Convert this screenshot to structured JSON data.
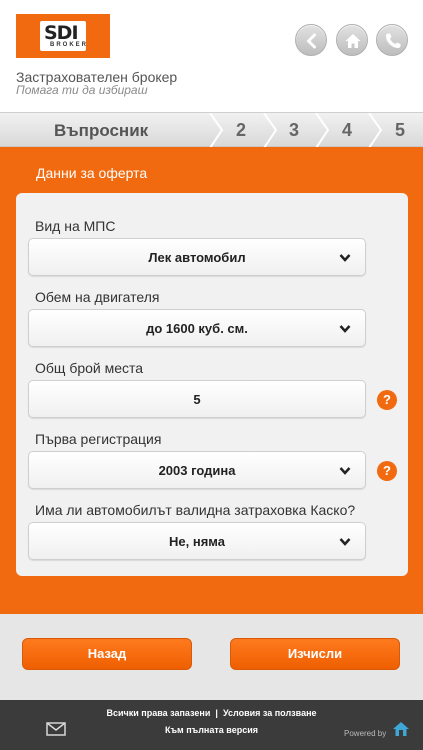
{
  "header": {
    "logo_text": "SDI",
    "logo_sub": "BROKER",
    "tagline": "Застрахователен брокер",
    "subtagline": "Помага ти да избираш",
    "icons": [
      "back-icon",
      "home-icon",
      "phone-icon"
    ]
  },
  "steps": {
    "current": "Въпросник",
    "others": [
      "2",
      "3",
      "4",
      "5"
    ]
  },
  "panel": {
    "title": "Данни за оферта"
  },
  "form": {
    "vehicle_type": {
      "label": "Вид на МПС",
      "value": "Лек автомобил"
    },
    "engine": {
      "label": "Обем на двигателя",
      "value": "до 1600 куб. см."
    },
    "seats": {
      "label": "Общ брой места",
      "value": "5"
    },
    "registration": {
      "label": "Първа регистрация",
      "value": "2003 година"
    },
    "casco": {
      "label": "Има ли автомобилът валидна затраховка Каско?",
      "value": "Не, няма"
    }
  },
  "buttons": {
    "back": "Назад",
    "calculate": "Изчисли"
  },
  "footer": {
    "rights": "Всички права запазени",
    "separator": "|",
    "terms": "Условия за ползване",
    "full_version": "Към пълната версия",
    "powered": "Powered by"
  },
  "colors": {
    "accent": "#f26a0f",
    "card": "#f1f1f1",
    "footer": "#3b3b3b"
  }
}
